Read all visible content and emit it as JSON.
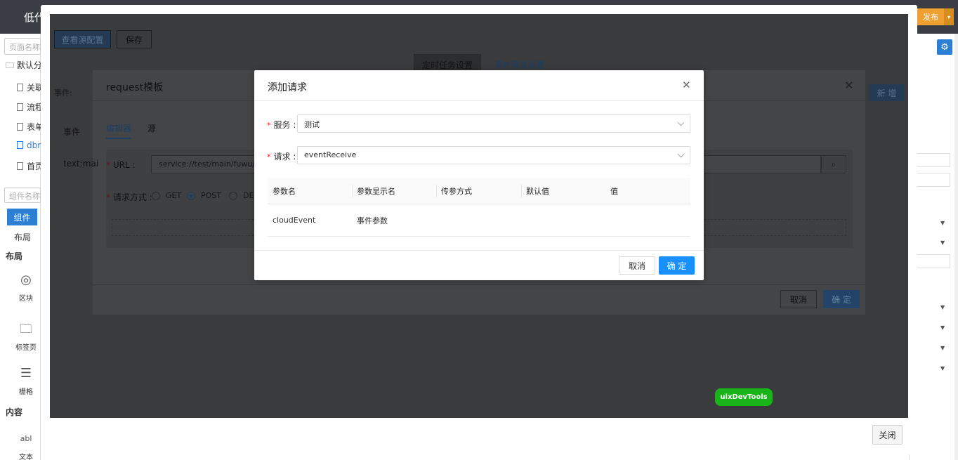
{
  "app": {
    "title": "低代",
    "publish_label": "发布",
    "publish_caret": "▾"
  },
  "left_panel": {
    "page_search_placeholder": "页面名称",
    "group": "默认分",
    "items": [
      {
        "label": "关联"
      },
      {
        "label": "流程"
      },
      {
        "label": "表单"
      },
      {
        "label": "dbr"
      },
      {
        "label": "首页"
      }
    ],
    "component_search_placeholder": "组件名称",
    "tab_components": "组件",
    "tab_layout": "布局",
    "section_layout": "布局",
    "section_content": "内容",
    "components": [
      {
        "label": "区块",
        "icon": "block-icon"
      },
      {
        "label": "标签页",
        "icon": "folder-icon"
      },
      {
        "label": "栅格",
        "icon": "grid-icon"
      },
      {
        "label": "文本",
        "icon": "text-icon"
      }
    ]
  },
  "preview": {
    "view_source_label": "查看源配置",
    "save_label": "保存",
    "tab_timer": "定时任务设置",
    "tab_event": "事件派发设置",
    "new_label": "新 增",
    "event_label": "事件:",
    "close_label": "关闭",
    "devtools_label": "uixDevTools"
  },
  "request_template": {
    "title": "request模板",
    "side_event": "事件",
    "side_text": "text:mai",
    "tab_editor": "编辑器",
    "tab_source": "源",
    "url_label": "URL :",
    "url_value": "service://test/main/fuwu/event",
    "method_label": "请求方式 :",
    "methods": [
      "GET",
      "POST",
      "DEL"
    ],
    "selected_method": "POST",
    "cancel_label": "取消",
    "ok_label": "确 定"
  },
  "add_request": {
    "title": "添加请求",
    "service_label": "服务 :",
    "service_value": "测试",
    "request_label": "请求 :",
    "request_value": "eventReceive",
    "columns": [
      "参数名",
      "参数显示名",
      "传参方式",
      "默认值",
      "值"
    ],
    "rows": [
      {
        "name": "cloudEvent",
        "display": "事件参数",
        "mode": "",
        "default": "",
        "value": ""
      }
    ],
    "cancel_label": "取消",
    "ok_label": "确 定"
  },
  "colors": {
    "primary": "#1890ff",
    "overlay_bg": "#3a3b3d",
    "required": "#f5222d",
    "devtools": "#19b419",
    "publish": "#f0a030"
  }
}
